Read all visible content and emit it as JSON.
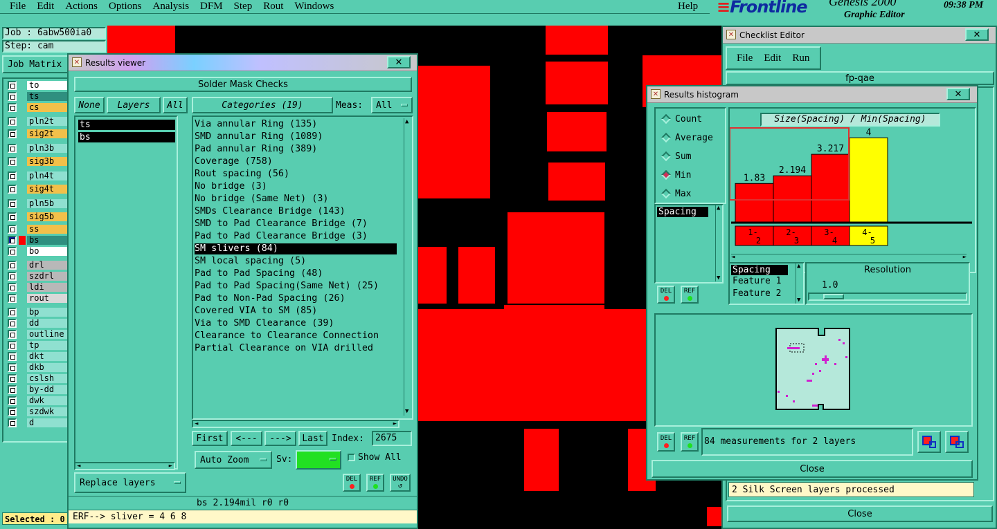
{
  "menubar": {
    "items": [
      "File",
      "Edit",
      "Actions",
      "Options",
      "Analysis",
      "DFM",
      "Step",
      "Rout",
      "Windows"
    ],
    "help": "Help"
  },
  "brand": {
    "logo": "Frontline",
    "product": "Genesis 2000",
    "subtitle": "Graphic Editor",
    "clock": "09:38 PM"
  },
  "job": {
    "job_label": "Job : 6abw500ia0",
    "step_label": "Step: cam",
    "matrix_button": "Job Matrix"
  },
  "layers": [
    {
      "name": "to",
      "color": "#ffffff"
    },
    {
      "name": "ts",
      "color": "#2f8f7f"
    },
    {
      "name": "cs",
      "color": "#f2c04a"
    },
    {
      "name": "pln2t",
      "color": "#8fe0d0"
    },
    {
      "name": "sig2t",
      "color": "#f2c04a"
    },
    {
      "name": "pln3b",
      "color": "#8fe0d0"
    },
    {
      "name": "sig3b",
      "color": "#f2c04a"
    },
    {
      "name": "pln4t",
      "color": "#8fe0d0"
    },
    {
      "name": "sig4t",
      "color": "#f2c04a"
    },
    {
      "name": "pln5b",
      "color": "#8fe0d0"
    },
    {
      "name": "sig5b",
      "color": "#f2c04a"
    },
    {
      "name": "ss",
      "color": "#f2c04a"
    },
    {
      "name": "bs",
      "color": "#2f8f7f"
    },
    {
      "name": "bo",
      "color": "#ffffff"
    },
    {
      "name": "drl",
      "color": "#b8b8b8"
    },
    {
      "name": "szdrl",
      "color": "#b8b8b8"
    },
    {
      "name": "ldi",
      "color": "#b8b8b8"
    },
    {
      "name": "rout",
      "color": "#d8d8d8"
    },
    {
      "name": "bp",
      "color": "#8fe0d0"
    },
    {
      "name": "dd",
      "color": "#8fe0d0"
    },
    {
      "name": "outline",
      "color": "#8fe0d0"
    },
    {
      "name": "tp",
      "color": "#8fe0d0"
    },
    {
      "name": "dkt",
      "color": "#8fe0d0"
    },
    {
      "name": "dkb",
      "color": "#8fe0d0"
    },
    {
      "name": "cslsh",
      "color": "#8fe0d0"
    },
    {
      "name": "by-dd",
      "color": "#8fe0d0"
    },
    {
      "name": "dwk",
      "color": "#8fe0d0"
    },
    {
      "name": "szdwk",
      "color": "#8fe0d0"
    },
    {
      "name": "d",
      "color": "#8fe0d0"
    }
  ],
  "selected_label": "Selected : 0",
  "results_viewer": {
    "title": "Results viewer",
    "header": "Solder Mask Checks",
    "none_btn": "None",
    "layers_btn": "Layers",
    "all_btn": "All",
    "categories_btn": "Categories (19)",
    "meas_label": "Meas:",
    "meas_value": "All",
    "layer_items": [
      "ts",
      "bs"
    ],
    "categories": [
      "Via annular Ring (135)",
      "SMD annular Ring (1089)",
      "Pad annular Ring (389)",
      "Coverage (758)",
      "Rout spacing (56)",
      "No bridge (3)",
      "No bridge (Same Net) (3)",
      "SMDs Clearance Bridge (143)",
      "SMD to Pad Clearance Bridge (7)",
      "Pad to Pad Clearance Bridge (3)",
      "SM slivers (84)",
      "SM local spacing (5)",
      "Pad to Pad Spacing (48)",
      "Pad to Pad Spacing(Same Net) (25)",
      "Pad to Non-Pad Spacing (26)",
      "Covered VIA to SM (85)",
      "Via to SMD Clearance (39)",
      "Clearance to Clearance Connection",
      "Partial Clearance on VIA drilled"
    ],
    "selected_index": 10,
    "first_btn": "First",
    "prev_btn": "<---",
    "next_btn": "--->",
    "last_btn": "Last",
    "index_label": "Index:",
    "index_value": "2675",
    "autozoom_btn": "Auto Zoom",
    "sv_label": "Sv:",
    "showall_label": "Show All",
    "replace_btn": "Replace layers",
    "del_btn": "DEL",
    "ref_btn": "REF",
    "undo_btn": "UNDO",
    "status": "bs 2.194mil  r0  r0",
    "erf": "ERF--> sliver = 4 6 8"
  },
  "checklist": {
    "title": "Checklist Editor",
    "menu": [
      "File",
      "Edit",
      "Run"
    ],
    "name": "fp-qae",
    "bottom_msg": "2 Silk Screen layers processed",
    "close_btn": "Close"
  },
  "histogram": {
    "title": "Results histogram",
    "radios": [
      {
        "label": "Count",
        "selected": false
      },
      {
        "label": "Average",
        "selected": false
      },
      {
        "label": "Sum",
        "selected": false
      },
      {
        "label": "Min",
        "selected": true
      },
      {
        "label": "Max",
        "selected": false
      }
    ],
    "chart_title": "Size(Spacing) / Min(Spacing)",
    "bars": [
      {
        "label": "1.83",
        "bin": [
          "1-",
          "2"
        ],
        "value": 1.83,
        "color": "#ff0000"
      },
      {
        "label": "2.194",
        "bin": [
          "2-",
          "3"
        ],
        "value": 2.194,
        "color": "#ff0000"
      },
      {
        "label": "3.217",
        "bin": [
          "3-",
          "4"
        ],
        "value": 3.217,
        "color": "#ff0000"
      },
      {
        "label": "4",
        "bin": [
          "4-",
          "5"
        ],
        "value": 4,
        "color": "#ffff00"
      }
    ],
    "ymax": 4.6,
    "left_list": [
      "Spacing"
    ],
    "feature_list": [
      "Spacing",
      "Feature 1",
      "Feature 2"
    ],
    "resolution_label": "Resolution",
    "resolution_value": "1.0",
    "del_btn": "DEL",
    "ref_btn": "REF",
    "summary": "84 measurements for 2 layers",
    "close_btn": "Close"
  }
}
